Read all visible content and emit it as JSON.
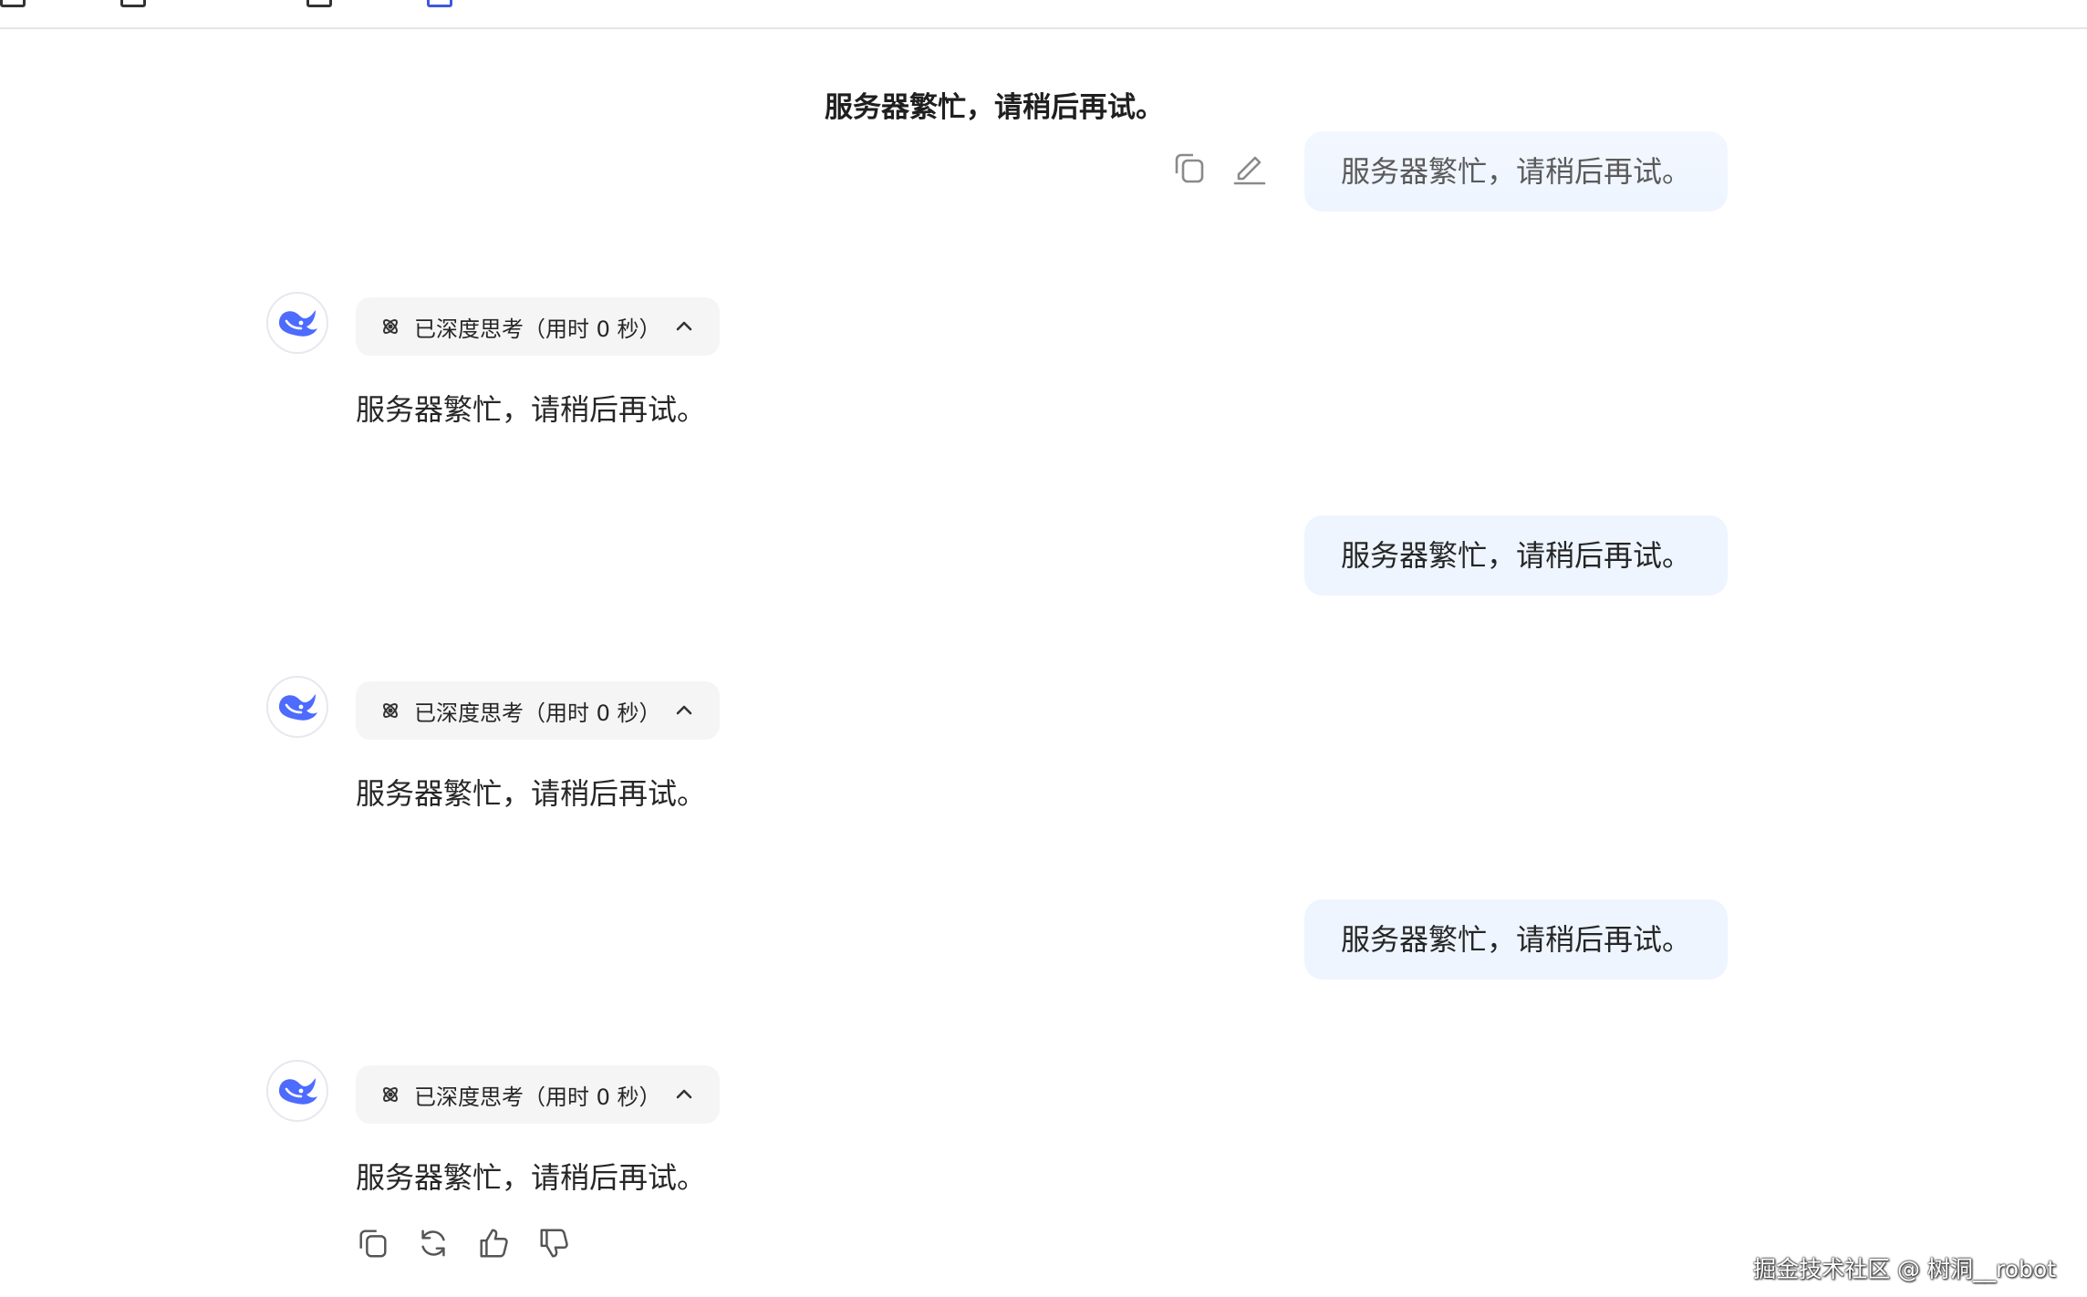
{
  "conversation": {
    "title": "服务器繁忙，请稍后再试。"
  },
  "messages": [
    {
      "role": "user",
      "text": "服务器繁忙，请稍后再试。"
    },
    {
      "role": "assistant",
      "thinking_label": "已深度思考（用时 0 秒）",
      "text": "服务器繁忙，请稍后再试。"
    },
    {
      "role": "user",
      "text": "服务器繁忙，请稍后再试。"
    },
    {
      "role": "assistant",
      "thinking_label": "已深度思考（用时 0 秒）",
      "text": "服务器繁忙，请稍后再试。"
    },
    {
      "role": "user",
      "text": "服务器繁忙，请稍后再试。"
    },
    {
      "role": "assistant",
      "thinking_label": "已深度思考（用时 0 秒）",
      "text": "服务器繁忙，请稍后再试。"
    }
  ],
  "icons": {
    "user_actions": [
      "copy-icon",
      "edit-icon"
    ],
    "assistant_actions": [
      "copy-icon",
      "regenerate-icon",
      "thumbs-up-icon",
      "thumbs-down-icon"
    ],
    "avatar": "whale-logo-icon",
    "thinking": "atom-icon",
    "collapse": "chevron-up-icon"
  },
  "colors": {
    "user_bubble": "#eef5ff",
    "thinking_chip": "#f5f5f5",
    "brand_blue": "#4d6bfe"
  },
  "watermark": "掘金技术社区 @ 树洞__robot"
}
